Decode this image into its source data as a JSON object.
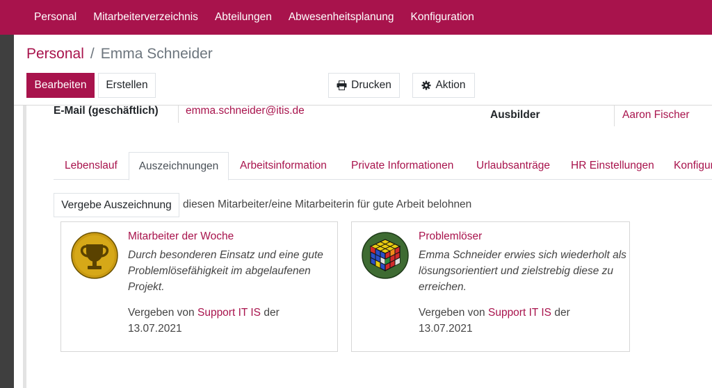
{
  "topnav": {
    "items": [
      "Personal",
      "Mitarbeiterverzeichnis",
      "Abteilungen",
      "Abwesenheitsplanung",
      "Konfiguration"
    ]
  },
  "breadcrumb": {
    "parent": "Personal",
    "separator": "/",
    "current": "Emma Schneider"
  },
  "actions": {
    "edit": "Bearbeiten",
    "create": "Erstellen",
    "print": "Drucken",
    "action": "Aktion"
  },
  "fields": {
    "email_label": "E-Mail (geschäftlich)",
    "email_value": "emma.schneider@itis.de",
    "trainer_label": "Ausbilder",
    "trainer_value": "Aaron Fischer"
  },
  "tabs": [
    "Lebenslauf",
    "Auszeichnungen",
    "Arbeitsinformation",
    "Private Informationen",
    "Urlaubsanträge",
    "HR Einstellungen",
    "Konfigur"
  ],
  "active_tab": "Auszeichnungen",
  "awards": {
    "grant_button": "Vergebe Auszeichnung",
    "grant_hint": "diesen Mitarbeiter/eine Mitarbeiterin für gute Arbeit belohnen",
    "cards": [
      {
        "title": "Mitarbeiter der Woche",
        "description": "Durch besonderen Einsatz und eine gute Problemlösefähigkeit im abgelaufenen Projekt.",
        "given_prefix": "Vergeben von",
        "given_by": "Support IT IS",
        "given_mid": "der",
        "date": "13.07.2021",
        "icon": "trophy-icon"
      },
      {
        "title": "Problemlöser",
        "description": "Emma Schneider erwies sich wiederholt als lösungsorientiert und zielstrebig diese zu erreichen.",
        "given_prefix": "Vergeben von",
        "given_by": "Support IT IS",
        "given_mid": "der",
        "date": "13.07.2021",
        "icon": "rubiks-cube-icon"
      }
    ]
  },
  "colors": {
    "brand": "#a8134c",
    "sidebar": "#3f3f3f"
  }
}
